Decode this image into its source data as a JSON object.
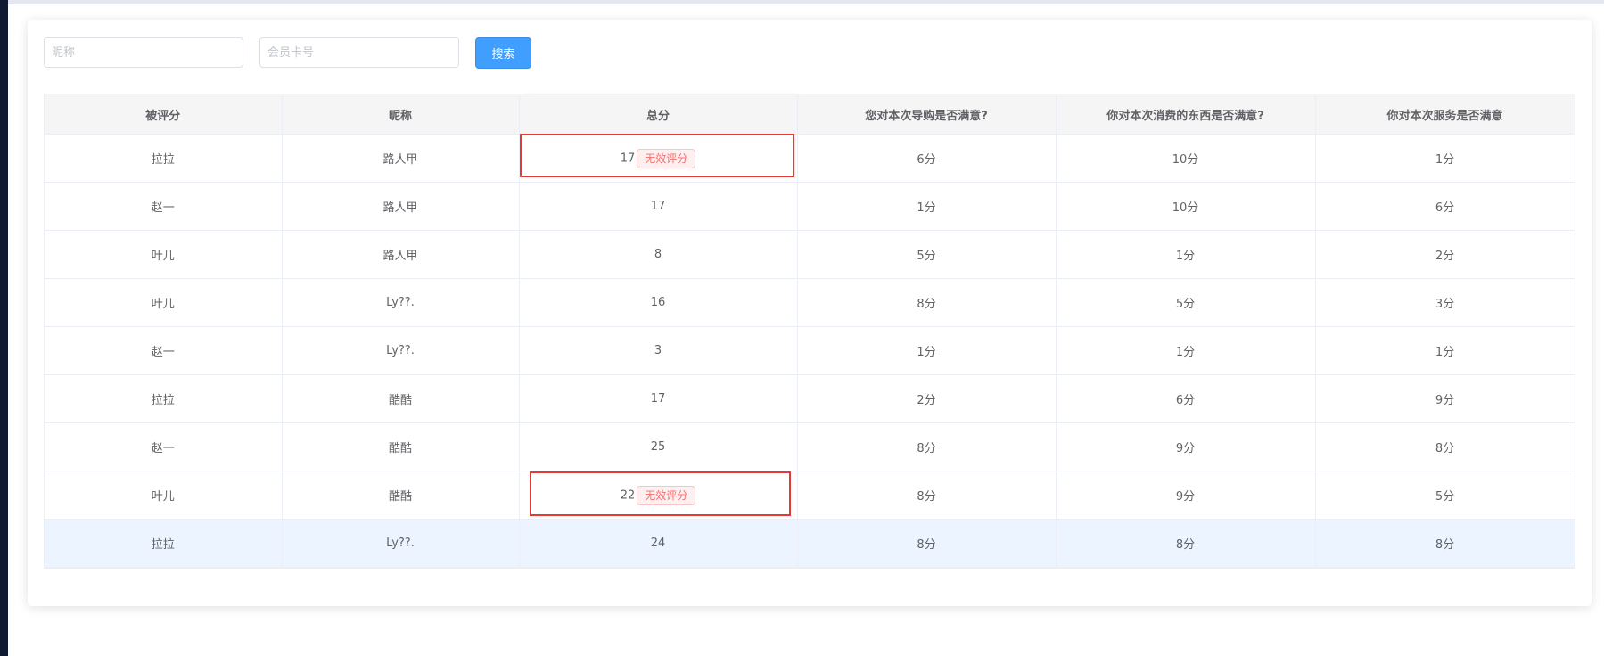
{
  "search": {
    "nickname_placeholder": "昵称",
    "card_placeholder": "会员卡号",
    "button_label": "搜索"
  },
  "table": {
    "headers": [
      "被评分",
      "昵称",
      "总分",
      "您对本次导购是否满意?",
      "你对本次消费的东西是否满意?",
      "你对本次服务是否满意"
    ],
    "rows": [
      {
        "rated": "拉拉",
        "nickname": "路人甲",
        "total": "17",
        "badge": "无效评分",
        "q1": "6分",
        "q2": "10分",
        "q3": "1分"
      },
      {
        "rated": "赵一",
        "nickname": "路人甲",
        "total": "17",
        "badge": "",
        "q1": "1分",
        "q2": "10分",
        "q3": "6分"
      },
      {
        "rated": "叶儿",
        "nickname": "路人甲",
        "total": "8",
        "badge": "",
        "q1": "5分",
        "q2": "1分",
        "q3": "2分"
      },
      {
        "rated": "叶儿",
        "nickname": "Ly??.",
        "total": "16",
        "badge": "",
        "q1": "8分",
        "q2": "5分",
        "q3": "3分"
      },
      {
        "rated": "赵一",
        "nickname": "Ly??.",
        "total": "3",
        "badge": "",
        "q1": "1分",
        "q2": "1分",
        "q3": "1分"
      },
      {
        "rated": "拉拉",
        "nickname": "酷酷",
        "total": "17",
        "badge": "",
        "q1": "2分",
        "q2": "6分",
        "q3": "9分"
      },
      {
        "rated": "赵一",
        "nickname": "酷酷",
        "total": "25",
        "badge": "",
        "q1": "8分",
        "q2": "9分",
        "q3": "8分"
      },
      {
        "rated": "叶儿",
        "nickname": "酷酷",
        "total": "22",
        "badge": "无效评分",
        "q1": "8分",
        "q2": "9分",
        "q3": "5分"
      },
      {
        "rated": "拉拉",
        "nickname": "Ly??.",
        "total": "24",
        "badge": "",
        "q1": "8分",
        "q2": "8分",
        "q3": "8分"
      }
    ]
  },
  "colors": {
    "primary": "#409eff",
    "badge_text": "#f56c6c",
    "annotation": "#e53935",
    "row_highlight": "#ecf5ff"
  }
}
